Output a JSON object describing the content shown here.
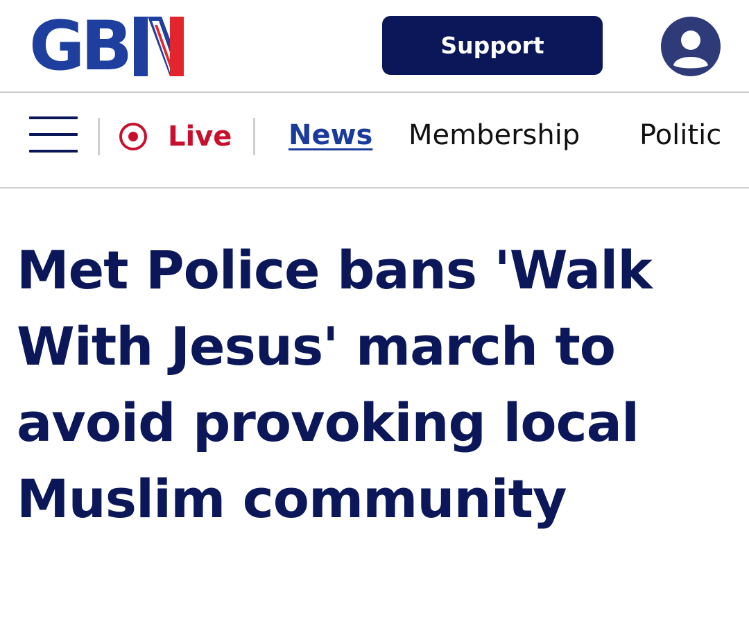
{
  "header": {
    "logo_text": "GB",
    "logo_colors": {
      "primary": "#1e3f9d",
      "accent_red": "#e3262d",
      "accent_white": "#ffffff"
    },
    "support_label": "Support",
    "avatar_icon": "user-avatar-icon"
  },
  "nav": {
    "menu_icon": "hamburger-menu-icon",
    "live_label": "Live",
    "live_icon": "live-record-icon",
    "items": [
      {
        "label": "News",
        "active": true
      },
      {
        "label": "Membership",
        "active": false
      },
      {
        "label": "Politic",
        "active": false
      }
    ]
  },
  "article": {
    "headline": "Met Police bans 'Walk With Jesus' march to avoid provoking local Muslim community"
  },
  "colors": {
    "navy": "#0b1759",
    "live_red": "#c8102e",
    "link_blue": "#1a3a9c"
  }
}
